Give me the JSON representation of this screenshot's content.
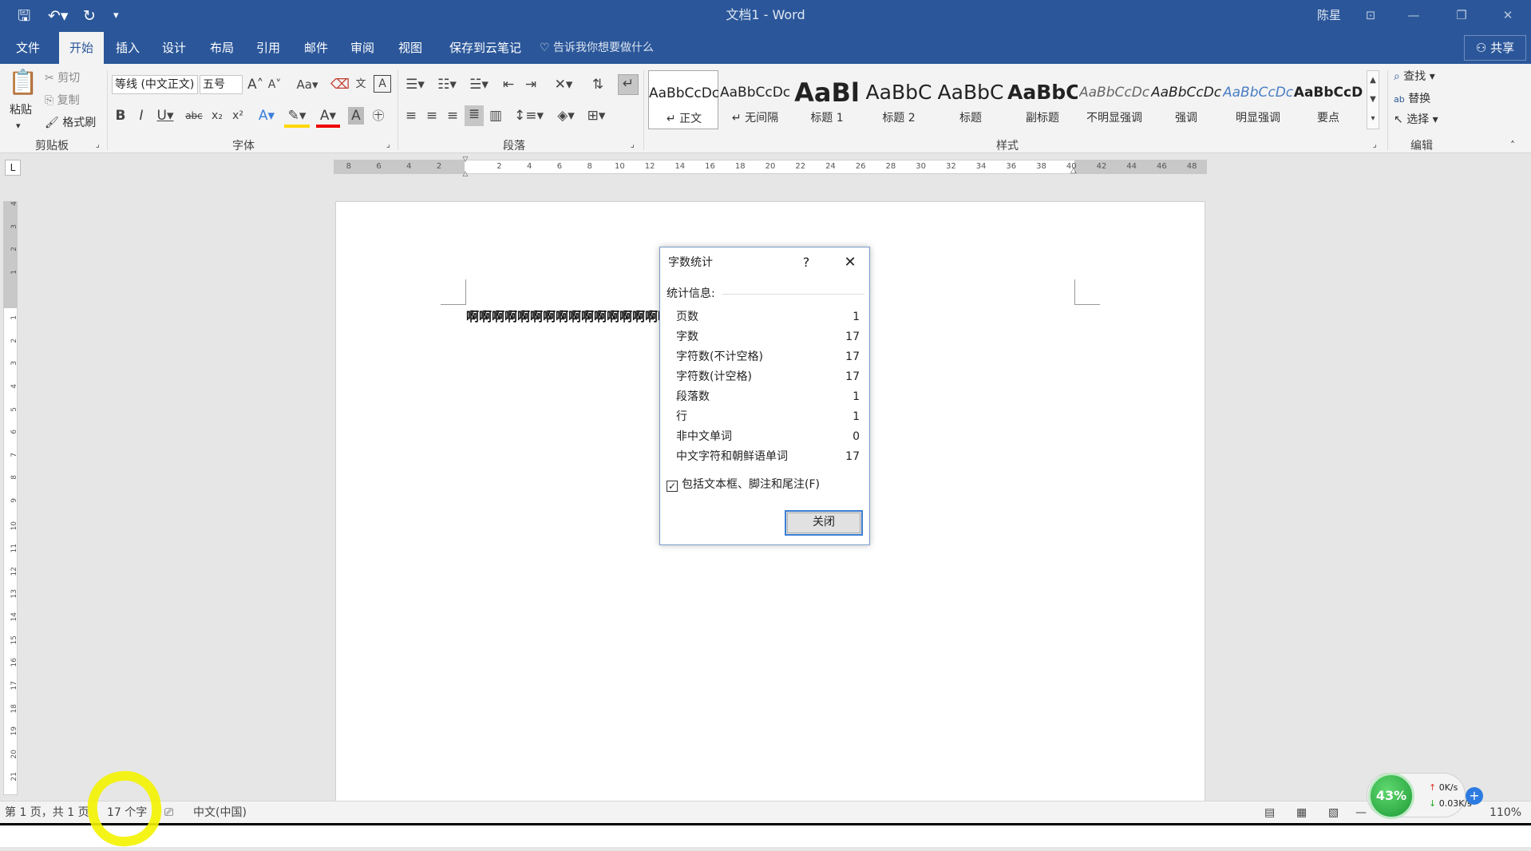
{
  "app": {
    "title": "文档1 - Word",
    "user": "陈星"
  },
  "tabs": [
    "文件",
    "开始",
    "插入",
    "设计",
    "布局",
    "引用",
    "邮件",
    "审阅",
    "视图",
    "保存到云笔记"
  ],
  "tell_me": "告诉我你想要做什么",
  "share": "共享",
  "clipboard": {
    "paste": "粘贴",
    "cut": "剪切",
    "copy": "复制",
    "format_painter": "格式刷",
    "label": "剪贴板"
  },
  "font": {
    "name": "等线 (中文正文)",
    "size": "五号",
    "label": "字体"
  },
  "paragraph": {
    "label": "段落"
  },
  "styles": {
    "label": "样式",
    "items": [
      {
        "sample": "AaBbCcDc",
        "name": "↵ 正文"
      },
      {
        "sample": "AaBbCcDc",
        "name": "↵ 无间隔"
      },
      {
        "sample": "AaBl",
        "name": "标题 1"
      },
      {
        "sample": "AaBbC",
        "name": "标题 2"
      },
      {
        "sample": "AaBbC",
        "name": "标题"
      },
      {
        "sample": "AaBbC",
        "name": "副标题"
      },
      {
        "sample": "AaBbCcDc",
        "name": "不明显强调"
      },
      {
        "sample": "AaBbCcDc",
        "name": "强调"
      },
      {
        "sample": "AaBbCcDc",
        "name": "明显强调"
      },
      {
        "sample": "AaBbCcD",
        "name": "要点"
      }
    ]
  },
  "editing": {
    "find": "查找",
    "replace": "替换",
    "select": "选择",
    "label": "编辑"
  },
  "ruler": {
    "h_ticks": [
      "8",
      "6",
      "4",
      "2",
      "",
      "2",
      "4",
      "6",
      "8",
      "10",
      "12",
      "14",
      "16",
      "18",
      "20",
      "22",
      "24",
      "26",
      "28",
      "30",
      "32",
      "34",
      "36",
      "38",
      "40",
      "42",
      "44",
      "46",
      "48"
    ],
    "v_ticks": [
      "4",
      "3",
      "2",
      "1",
      "",
      "1",
      "2",
      "3",
      "4",
      "5",
      "6",
      "7",
      "8",
      "9",
      "10",
      "11",
      "12",
      "13",
      "14",
      "15",
      "16",
      "17",
      "18",
      "19",
      "20",
      "21"
    ]
  },
  "document": {
    "text": "啊啊啊啊啊啊啊啊啊啊啊啊啊啊啊啊啊"
  },
  "dialog": {
    "title": "字数统计",
    "help": "?",
    "section": "统计信息:",
    "rows": [
      {
        "label": "页数",
        "value": "1"
      },
      {
        "label": "字数",
        "value": "17"
      },
      {
        "label": "字符数(不计空格)",
        "value": "17"
      },
      {
        "label": "字符数(计空格)",
        "value": "17"
      },
      {
        "label": "段落数",
        "value": "1"
      },
      {
        "label": "行",
        "value": "1"
      },
      {
        "label": "非中文单词",
        "value": "0"
      },
      {
        "label": "中文字符和朝鲜语单词",
        "value": "17"
      }
    ],
    "checkbox": "包括文本框、脚注和尾注(F)",
    "checked": true,
    "close": "关闭"
  },
  "status": {
    "page": "第 1 页，共 1 页",
    "words": "17 个字",
    "lang": "中文(中国)",
    "zoom": "110%"
  },
  "net": {
    "percent": "43%",
    "up": "0K/s",
    "down": "0.03K/s"
  },
  "colors": {
    "accent": "#2b579a",
    "highlight": "#f3f300"
  }
}
